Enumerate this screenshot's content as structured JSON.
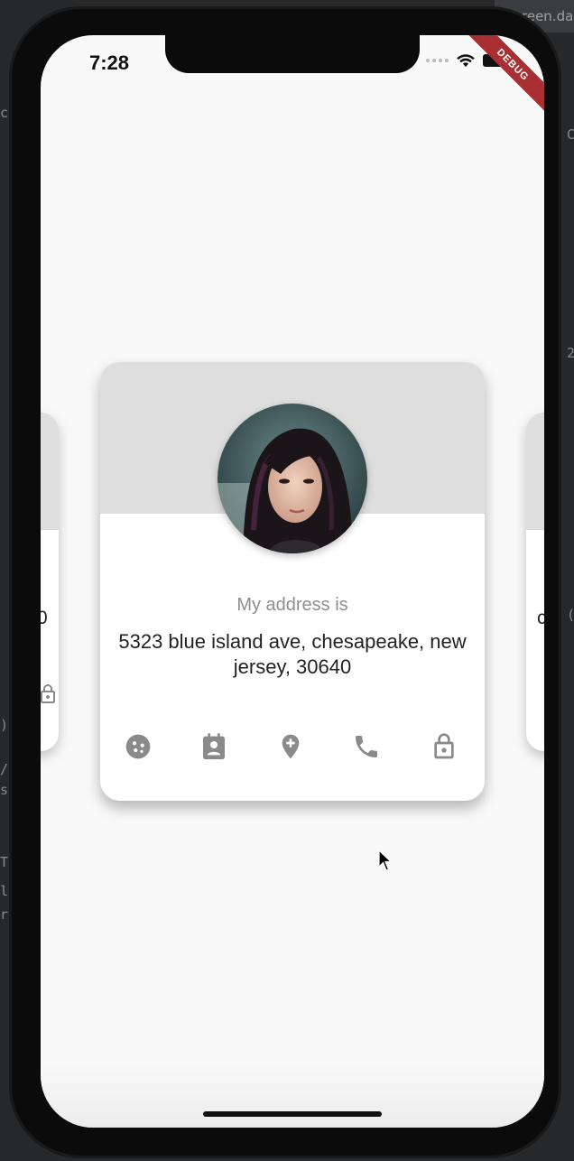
{
  "background": {
    "tab_label": "reen.da",
    "fragments": [
      "c",
      "2",
      ")",
      "/",
      "s",
      "T",
      "l",
      "r",
      "(",
      "C"
    ]
  },
  "status_bar": {
    "time": "7:28",
    "debug_label": "DEBUG"
  },
  "side_cards": {
    "left_text": "0",
    "right_text": "c-( )"
  },
  "profile_card": {
    "caption": "My address is",
    "value": "5323 blue island ave, chesapeake, new jersey, 30640",
    "icons": [
      "face-icon",
      "calendar-icon",
      "map-pin-icon",
      "phone-icon",
      "lock-icon"
    ],
    "active_icon": "map-pin-icon"
  },
  "colors": {
    "card_header": "#dedede",
    "icon_gray": "#8a8a8a",
    "debug_banner": "#a83033",
    "screen_bg": "#f9f9f9"
  }
}
